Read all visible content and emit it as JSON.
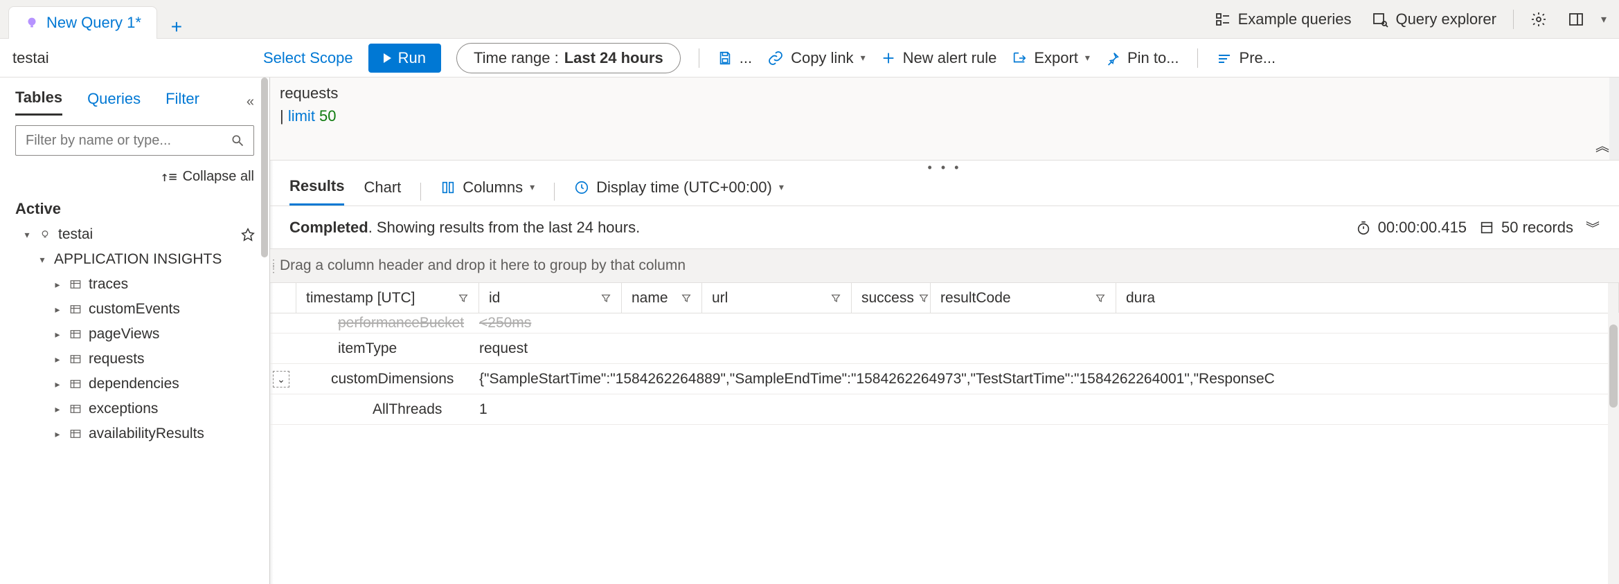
{
  "tab": {
    "title": "New Query 1*"
  },
  "topbar": {
    "example_queries": "Example queries",
    "query_explorer": "Query explorer"
  },
  "cmd": {
    "scope_name": "testai",
    "select_scope": "Select Scope",
    "run": "Run",
    "time_prefix": "Time range : ",
    "time_value": "Last 24 hours",
    "save_ellipsis": "...",
    "copy_link": "Copy link",
    "new_alert": "New alert rule",
    "export": "Export",
    "pin_to": "Pin to...",
    "preview": "Pre..."
  },
  "left": {
    "tabs": [
      "Tables",
      "Queries",
      "Filter"
    ],
    "active_tab_index": 0,
    "filter_placeholder": "Filter by name or type...",
    "collapse_all": "Collapse all",
    "active_heading": "Active",
    "root": "testai",
    "group": "APPLICATION INSIGHTS",
    "items": [
      "traces",
      "customEvents",
      "pageViews",
      "requests",
      "dependencies",
      "exceptions",
      "availabilityResults"
    ]
  },
  "editor": {
    "line1": "requests",
    "line2_pipe": "|",
    "line2_kw": " limit ",
    "line2_num": "50"
  },
  "results": {
    "tabs": [
      "Results",
      "Chart"
    ],
    "active_tab_index": 0,
    "columns_btn": "Columns",
    "display_time": "Display time (UTC+00:00)",
    "status_strong": "Completed",
    "status_rest": ". Showing results from the last 24 hours.",
    "duration": "00:00:00.415",
    "record_count": "50 records",
    "group_hint": "Drag a column header and drop it here to group by that column",
    "cols": [
      "timestamp [UTC]",
      "id",
      "name",
      "url",
      "success",
      "resultCode",
      "dura"
    ],
    "rows": {
      "partial_key": "performanceBucket",
      "partial_val": "<250ms",
      "r1_key": "itemType",
      "r1_val": "request",
      "r2_key": "customDimensions",
      "r2_val": "{\"SampleStartTime\":\"1584262264889\",\"SampleEndTime\":\"1584262264973\",\"TestStartTime\":\"1584262264001\",\"ResponseC",
      "r3_key": "AllThreads",
      "r3_val": "1"
    }
  }
}
